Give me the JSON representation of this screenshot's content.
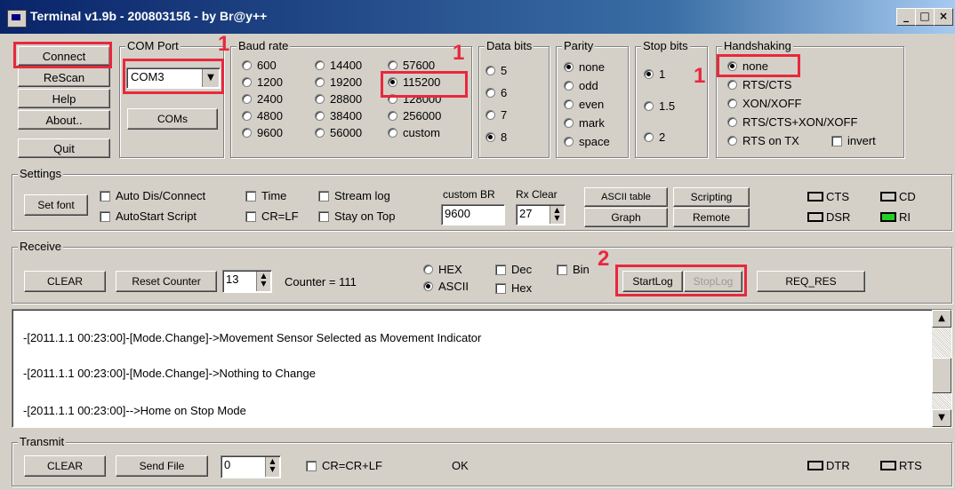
{
  "window": {
    "title": "Terminal v1.9b - 20080315ß - by Br@y++",
    "minimize": "_",
    "maximize": "□",
    "close": "×"
  },
  "left_buttons": {
    "connect": "Connect",
    "rescan": "ReScan",
    "help": "Help",
    "about": "About..",
    "quit": "Quit"
  },
  "com_port": {
    "label": "COM Port",
    "value": "COM3",
    "coms_button": "COMs"
  },
  "baud_rate": {
    "label": "Baud rate",
    "options": [
      "600",
      "1200",
      "2400",
      "4800",
      "9600",
      "14400",
      "19200",
      "28800",
      "38400",
      "56000",
      "57600",
      "115200",
      "128000",
      "256000",
      "custom"
    ],
    "selected": "115200"
  },
  "data_bits": {
    "label": "Data bits",
    "options": [
      "5",
      "6",
      "7",
      "8"
    ],
    "selected": "8"
  },
  "parity": {
    "label": "Parity",
    "options": [
      "none",
      "odd",
      "even",
      "mark",
      "space"
    ],
    "selected": "none"
  },
  "stop_bits": {
    "label": "Stop bits",
    "options": [
      "1",
      "1.5",
      "2"
    ],
    "selected": "1"
  },
  "handshaking": {
    "label": "Handshaking",
    "options": [
      "none",
      "RTS/CTS",
      "XON/XOFF",
      "RTS/CTS+XON/XOFF",
      "RTS on TX"
    ],
    "selected": "none",
    "invert": "invert"
  },
  "settings": {
    "label": "Settings",
    "set_font": "Set font",
    "checks": {
      "auto_dis": "Auto Dis/Connect",
      "autostart": "AutoStart Script",
      "time": "Time",
      "crlf": "CR=LF",
      "stream_log": "Stream log",
      "stay_on_top": "Stay on Top"
    },
    "custom_br_label": "custom BR",
    "custom_br_value": "9600",
    "rx_clear_label": "Rx Clear",
    "rx_clear_value": "27",
    "ascii_table": "ASCII table",
    "scripting": "Scripting",
    "graph": "Graph",
    "remote": "Remote",
    "leds": {
      "cts": "CTS",
      "cd": "CD",
      "dsr": "DSR",
      "ri": "RI"
    }
  },
  "receive": {
    "label": "Receive",
    "clear": "CLEAR",
    "reset_counter": "Reset Counter",
    "counter_spin": "13",
    "counter_text": "Counter = 111",
    "hex": "HEX",
    "ascii": "ASCII",
    "dec": "Dec",
    "hex2": "Hex",
    "bin": "Bin",
    "start_log": "StartLog",
    "stop_log": "StopLog",
    "req_res": "REQ_RES"
  },
  "terminal_lines": [
    "-[2011.1.1 00:23:00]-[Mode.Change]->Movement Sensor Selected as Movement Indicator",
    "-[2011.1.1 00:23:00]-[Mode.Change]->Nothing to Change",
    "-[2011.1.1 00:23:00]-->Home on Stop Mode"
  ],
  "transmit": {
    "label": "Transmit",
    "clear": "CLEAR",
    "send_file": "Send File",
    "spin_value": "0",
    "crcr": "CR=CR+LF",
    "status": "OK",
    "dtr": "DTR",
    "rts": "RTS"
  },
  "annotations": {
    "one": "1",
    "two": "2"
  },
  "colors": {
    "annotation_red": "#e8283c",
    "ri_led": "#24d024",
    "title_blue": "#0a246a"
  }
}
